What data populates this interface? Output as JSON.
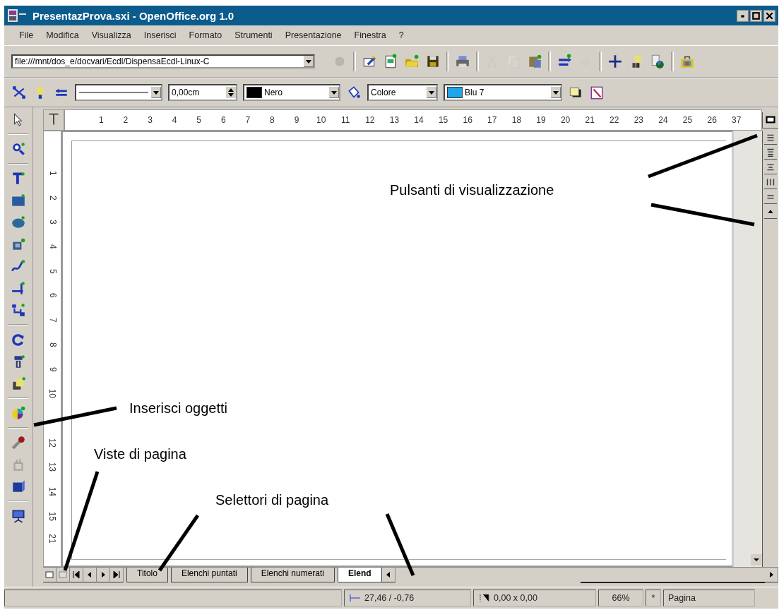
{
  "window": {
    "title": "PresentazProva.sxi - OpenOffice.org 1.0"
  },
  "menu": [
    "File",
    "Modifica",
    "Visualizza",
    "Inserisci",
    "Formato",
    "Strumenti",
    "Presentazione",
    "Finestra",
    "?"
  ],
  "function_bar": {
    "url": "file:///mnt/dos_e/docvari/Ecdl/DispensaEcdl-Linux-C",
    "buttons": [
      {
        "disabled": true
      },
      {
        "disabled": false
      },
      {
        "disabled": false
      },
      {
        "disabled": false
      },
      {
        "disabled": false
      },
      {
        "disabled": false
      },
      {
        "disabled": true
      },
      {
        "disabled": true
      },
      {
        "disabled": false
      },
      {
        "disabled": false
      },
      {
        "disabled": true
      },
      {
        "disabled": false
      },
      {
        "disabled": false
      },
      {
        "disabled": false
      },
      {
        "disabled": false
      }
    ]
  },
  "object_bar": {
    "line_width": "0,00cm",
    "line_color": {
      "label": "Nero",
      "color": "#000000"
    },
    "area_style": "Colore",
    "area_fill": {
      "label": "Blu 7",
      "color": "#1ea6e8"
    }
  },
  "ruler": {
    "horizontal": [
      "1",
      "2",
      "3",
      "4",
      "5",
      "6",
      "7",
      "8",
      "9",
      "10",
      "11",
      "12",
      "13",
      "14",
      "15",
      "16",
      "17",
      "18",
      "19",
      "20",
      "21",
      "22",
      "23",
      "24",
      "25",
      "26",
      "37"
    ],
    "vertical": [
      "1",
      "2",
      "3",
      "4",
      "5",
      "6",
      "7",
      "8",
      "9",
      "10",
      "12",
      "13",
      "14",
      "15",
      "21"
    ]
  },
  "main_toolbar": [
    {
      "disabled": false
    },
    {
      "disabled": false
    },
    {
      "disabled": false
    },
    {
      "disabled": false
    },
    {
      "disabled": false
    },
    {
      "disabled": false
    },
    {
      "disabled": false
    },
    {
      "disabled": false
    },
    {
      "disabled": false
    },
    {
      "disabled": false
    },
    {
      "disabled": false
    },
    {
      "disabled": false
    },
    {
      "disabled": false
    },
    {
      "disabled": false
    },
    {
      "disabled": true
    },
    {
      "disabled": false
    },
    {
      "disabled": false
    }
  ],
  "page_tabs": [
    {
      "label": "Titolo",
      "selected": false
    },
    {
      "label": "Elenchi puntati",
      "selected": false
    },
    {
      "label": "Elenchi numerati",
      "selected": false
    },
    {
      "label": "Elend",
      "selected": true
    }
  ],
  "status_bar": {
    "position": "27,46 / -0,76",
    "size": "0,00 x 0,00",
    "zoom": "66%",
    "modified": "*",
    "mode": "Pagina"
  },
  "annotations": [
    "Pulsanti di visualizzazione",
    "Inserisci oggetti",
    "Viste di pagina",
    "Selettori di pagina"
  ]
}
